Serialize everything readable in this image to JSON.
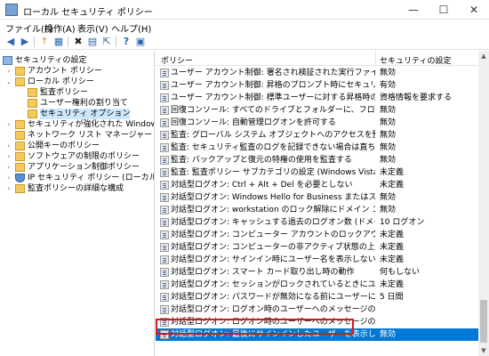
{
  "window": {
    "title": "ローカル セキュリティ ポリシー",
    "minimize": "—",
    "maximize": "☐",
    "close": "✕"
  },
  "menu": [
    "ファイル(F)",
    "操作(A)",
    "表示(V)",
    "ヘルプ(H)"
  ],
  "toolbar": {
    "back": "◀",
    "forward": "▶",
    "up": "↑",
    "show_tree": "▦",
    "delete": "✖",
    "properties": "▤",
    "export": "⇱",
    "help": "?",
    "view": "▣"
  },
  "tree": {
    "root": "セキュリティの設定",
    "items": [
      "アカウント ポリシー",
      "ローカル ポリシー",
      "監査ポリシー",
      "ユーザー権利の割り当て",
      "セキュリティ オプション",
      "セキュリティが強化された Windows Defen",
      "ネットワーク リスト マネージャー ポリシー",
      "公開キーのポリシー",
      "ソフトウェアの制限のポリシー",
      "アプリケーション制御ポリシー",
      "IP セキュリティ ポリシー (ローカル コンピューター",
      "監査ポリシーの詳細な構成"
    ]
  },
  "list": {
    "columns": {
      "policy": "ポリシー",
      "setting": "セキュリティの設定"
    },
    "rows": [
      {
        "name": "ユーザー アカウント制御: 署名され検証された実行ファイルのみを昇格...",
        "value": "無効"
      },
      {
        "name": "ユーザー アカウント制御: 昇格のプロンプト時にセキュリティで保護され...",
        "value": "有効"
      },
      {
        "name": "ユーザー アカウント制御: 標準ユーザーに対する昇格時のプロンプトの...",
        "value": "資格情報を要求する"
      },
      {
        "name": "回復コンソール: すべてのドライブとフォルダーに、フロッピーのコピーとアクセ...",
        "value": "無効"
      },
      {
        "name": "回復コンソール: 自動管理ログオンを許可する",
        "value": "無効"
      },
      {
        "name": "監査: グローバル システム オブジェクトへのアクセスを監査する",
        "value": "無効"
      },
      {
        "name": "監査: セキュリティ監査のログを記録できない場合は直ちにシステムを...",
        "value": "無効"
      },
      {
        "name": "監査: バックアップと復元の特権の使用を監査する",
        "value": "無効"
      },
      {
        "name": "監査: 監査ポリシー サブカテゴリの設定 (Windows Vista 以降) を強...",
        "value": "未定義"
      },
      {
        "name": "対話型ログオン: Ctrl + Alt + Del を必要としない",
        "value": "未定義"
      },
      {
        "name": "対話型ログオン: Windows Hello for Business またはスマート カード...",
        "value": "無効"
      },
      {
        "name": "対話型ログオン: workstation のロック解除にドメイン コントローラーの...",
        "value": "無効"
      },
      {
        "name": "対話型ログオン: キャッシュする過去のログオン数 (ドメイン コントローラー...",
        "value": "10 ログオン"
      },
      {
        "name": "対話型ログオン: コンピューター アカウントのロックアウトのしきい値",
        "value": "未定義"
      },
      {
        "name": "対話型ログオン: コンピューターの非アクティブ状態の上限",
        "value": "未定義"
      },
      {
        "name": "対話型ログオン: サインイン時にユーザー名を表示しない",
        "value": "未定義"
      },
      {
        "name": "対話型ログオン: スマート カード取り出し時の動作",
        "value": "何もしない"
      },
      {
        "name": "対話型ログオン: セッションがロックされているときにユーザーの情報を表...",
        "value": "未定義"
      },
      {
        "name": "対話型ログオン: パスワードが無効になる前にユーザーに変更を促す",
        "value": "5 日間"
      },
      {
        "name": "対話型ログオン: ログオン時のユーザーへのメッセージのタイトル",
        "value": ""
      },
      {
        "name": "対話型ログオン: ログオン時のユーザーへのメッセージのテキスト",
        "value": ""
      },
      {
        "name": "対話型ログオン: 最後にサインインしたユーザーを表示しない",
        "value": "無効"
      }
    ],
    "selected_row": 21
  },
  "colors": {
    "selection": "#0078d7",
    "highlight_box": "#e0141e"
  }
}
